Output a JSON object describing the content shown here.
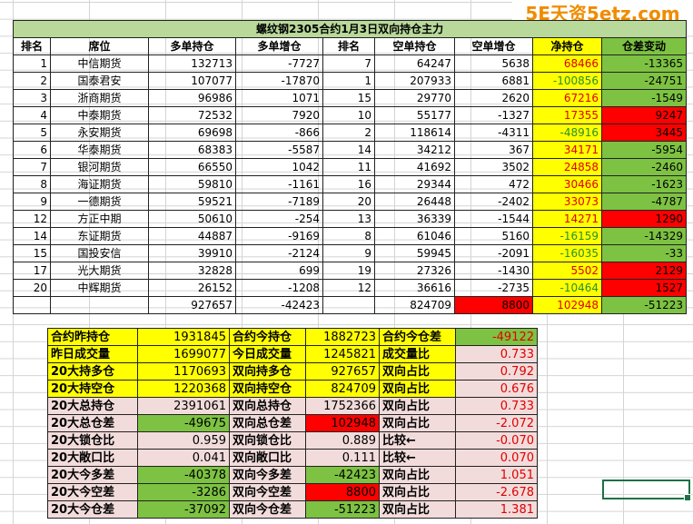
{
  "watermark": "5E天资5etz.com",
  "title": "螺纹钢2305合约1月3日双向持仓主力",
  "headers": [
    "排名",
    "席位",
    "多单持仓",
    "多单增仓",
    "排名",
    "空单持仓",
    "空单增仓",
    "净持仓",
    "仓差变动"
  ],
  "rows": [
    [
      "1",
      "中信期货",
      "132713",
      "-7727",
      "7",
      "64247",
      "5638",
      "68466",
      "-13365"
    ],
    [
      "2",
      "国泰君安",
      "107077",
      "-17870",
      "1",
      "207933",
      "6881",
      "-100856",
      "-24751"
    ],
    [
      "3",
      "浙商期货",
      "96986",
      "1071",
      "15",
      "29770",
      "2620",
      "67216",
      "-1549"
    ],
    [
      "4",
      "中泰期货",
      "72532",
      "7920",
      "10",
      "55177",
      "-1327",
      "17355",
      "9247"
    ],
    [
      "5",
      "永安期货",
      "69698",
      "-866",
      "2",
      "118614",
      "-4311",
      "-48916",
      "3445"
    ],
    [
      "6",
      "华泰期货",
      "68383",
      "-5587",
      "14",
      "34212",
      "367",
      "34171",
      "-5954"
    ],
    [
      "7",
      "银河期货",
      "66550",
      "1042",
      "11",
      "41692",
      "3502",
      "24858",
      "-2460"
    ],
    [
      "8",
      "海证期货",
      "59810",
      "-1161",
      "16",
      "29344",
      "472",
      "30466",
      "-1623"
    ],
    [
      "9",
      "一德期货",
      "59521",
      "-7189",
      "20",
      "26448",
      "-2402",
      "33073",
      "-4787"
    ],
    [
      "12",
      "方正中期",
      "50610",
      "-254",
      "13",
      "36339",
      "-1544",
      "14271",
      "1290"
    ],
    [
      "14",
      "东证期货",
      "44887",
      "-9169",
      "8",
      "61046",
      "5160",
      "-16159",
      "-14329"
    ],
    [
      "15",
      "国投安信",
      "39910",
      "-2124",
      "9",
      "59945",
      "-2091",
      "-16035",
      "-33"
    ],
    [
      "17",
      "光大期货",
      "32828",
      "699",
      "19",
      "27326",
      "-1430",
      "5502",
      "2129"
    ],
    [
      "20",
      "中辉期货",
      "26152",
      "-1208",
      "12",
      "36616",
      "-2735",
      "-10464",
      "1527"
    ]
  ],
  "totals": [
    "",
    "",
    "927657",
    "-42423",
    "",
    "824709",
    "8800",
    "102948",
    "-51223"
  ],
  "stats": [
    [
      "合约昨持仓",
      "1931845",
      "合约今持仓",
      "1882723",
      "合约今仓差",
      "-49122"
    ],
    [
      "昨日成交量",
      "1699077",
      "今日成交量",
      "1245821",
      "成交量比",
      "0.733"
    ],
    [
      "20大持多仓",
      "1170693",
      "双向持多仓",
      "927657",
      "双向占比",
      "0.792"
    ],
    [
      "20大持空仓",
      "1220368",
      "双向持空仓",
      "824709",
      "双向占比",
      "0.676"
    ],
    [
      "20大总持仓",
      "2391061",
      "双向总持仓",
      "1752366",
      "双向占比",
      "0.733"
    ],
    [
      "20大总仓差",
      "-49675",
      "双向总仓差",
      "102948",
      "双向占比",
      "-2.072"
    ],
    [
      "20大锁仓比",
      "0.959",
      "双向锁仓比",
      "0.889",
      "比较←",
      "-0.070"
    ],
    [
      "20大敞口比",
      "0.041",
      "双向敞口比",
      "0.111",
      "比较←",
      "0.070"
    ],
    [
      "20大今多差",
      "-40378",
      "双向今多差",
      "-42423",
      "双向占比",
      "1.051"
    ],
    [
      "20大今空差",
      "-3286",
      "双向今空差",
      "8800",
      "双向占比",
      "-2.678"
    ],
    [
      "20大今仓差",
      "-37092",
      "双向今仓差",
      "-51223",
      "双向占比",
      "1.381"
    ]
  ],
  "colors": {
    "yellow": "#ffff00",
    "green": "#7dc242",
    "red": "#ff0000",
    "pink": "#f2dcdb",
    "title_bg": "#b8d99a"
  }
}
